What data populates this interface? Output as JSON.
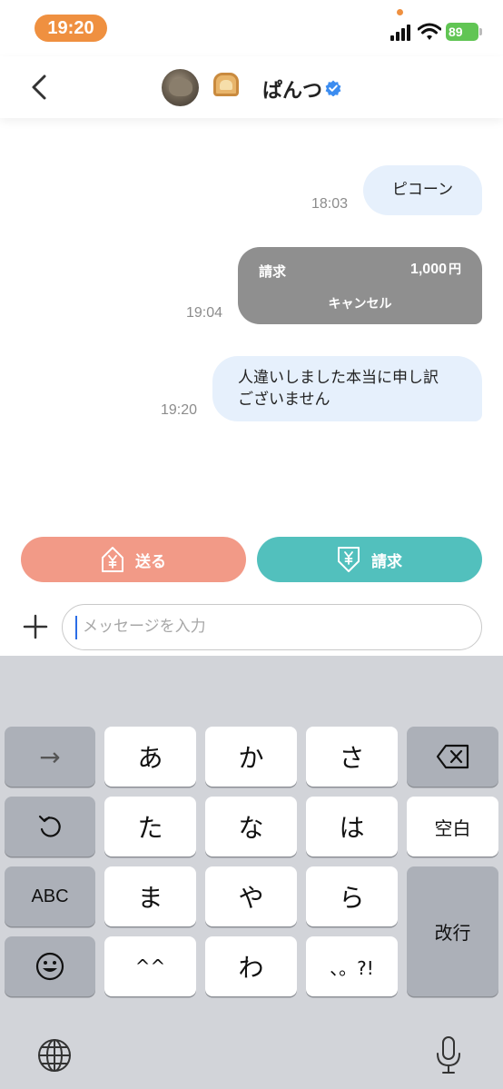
{
  "status_bar": {
    "time": "19:20",
    "battery": "89"
  },
  "header": {
    "title": "ぱんつ",
    "back_icon": "chevron-left-icon",
    "verified_icon": "verified-badge-icon"
  },
  "messages": [
    {
      "text": "ピコーン",
      "time": "18:03"
    },
    {
      "type": "bill",
      "label": "請求",
      "amount": "1,000",
      "currency": "円",
      "action": "キャンセル",
      "time": "19:04"
    },
    {
      "text_line1": "人違いしました本当に申し訳",
      "text_line2": "ございません",
      "time": "19:20"
    }
  ],
  "actions": {
    "send_label": "送る",
    "bill_label": "請求"
  },
  "composer": {
    "placeholder": "メッセージを入力"
  },
  "keyboard": {
    "row1": [
      "→",
      "あ",
      "か",
      "さ"
    ],
    "row2": [
      "た",
      "な",
      "は",
      "空白"
    ],
    "row3": [
      "ABC",
      "ま",
      "や",
      "ら",
      "改行"
    ],
    "row4": [
      "^^",
      "わ",
      "、。?!"
    ]
  },
  "colors": {
    "accent_orange": "#ef9040",
    "send_button": "#f29a87",
    "bill_button": "#52c0bd",
    "bubble": "#e6f0fc",
    "bill_bubble": "#8f8f8f"
  }
}
